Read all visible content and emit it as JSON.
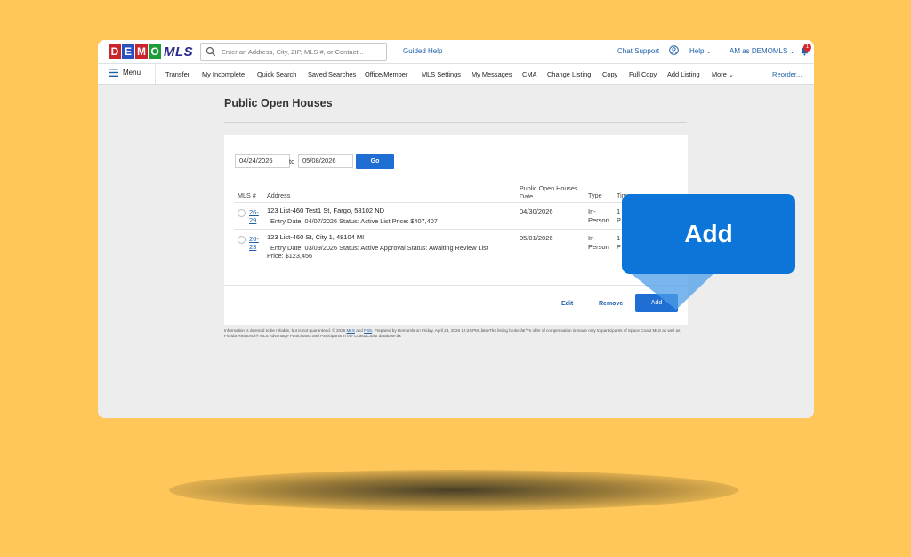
{
  "app": {
    "logo_letters": [
      "D",
      "E",
      "M",
      "O"
    ],
    "logo_colors": [
      "#C8252C",
      "#2A52BE",
      "#C8252C",
      "#1E9B3A"
    ],
    "logo_suffix": "MLS"
  },
  "topbar": {
    "search_placeholder": "Enter an Address, City, ZIP, MLS #, or Contact...",
    "guided_help": "Guided Help",
    "chat_support": "Chat Support",
    "help": "Help",
    "user": "AM as DEMOMLS",
    "notification_count": "1"
  },
  "nav": {
    "menu_label": "Menu",
    "items": [
      "Transfer",
      "My Incomplete",
      "Quick Search",
      "Saved Searches",
      "Office/Member",
      "MLS Settings",
      "My Messages",
      "CMA",
      "Change Listing",
      "Copy",
      "Full Copy",
      "Add Listing",
      "More"
    ],
    "reorder": "Reorder..."
  },
  "page": {
    "title": "Public Open Houses",
    "date_from": "04/24/2026",
    "to_label": "to",
    "date_to": "05/08/2026",
    "go_label": "Go"
  },
  "table": {
    "headers": {
      "mls": "MLS #",
      "address": "Address",
      "date_line1": "Public Open Houses",
      "date_line2": "Date",
      "type": "Type",
      "time": "Time"
    },
    "rows": [
      {
        "mls_line1": "26-",
        "mls_line2": "29",
        "address": "123 List-460 Test1 St, Fargo, 58102 ND",
        "details": "Entry Date: 04/07/2026   Status: Active   List Price: $407,407",
        "date": "04/30/2026",
        "type_line1": "In-",
        "type_line2": "Person",
        "time_line1": "1",
        "time_line2": "P"
      },
      {
        "mls_line1": "26-",
        "mls_line2": "23",
        "address": "123 List-460 St, City 1, 48104 MI",
        "details_line1": "Entry Date: 03/09/2026   Status: Active   Approval Status: Awaiting Review   List",
        "details_line2": "Price: $123,456",
        "date": "05/01/2026",
        "type_line1": "In-",
        "type_line2": "Person",
        "time_line1": "1",
        "time_line2": "P"
      }
    ]
  },
  "actions": {
    "edit": "Edit",
    "remove": "Remove",
    "add": "Add"
  },
  "disclaimer": {
    "part1": "Information is deemed to be reliable, but is not guaranteed. © 2026 ",
    "mls_link": "MLS",
    "and": " and ",
    "fbs_link": "FBS",
    "part2": ". Prepared by Demomls on Friday, April 24, 2026 12:24 PM. â€œThe listing brokerâ€™s offer of compensation is made only to participants of Space Coast MLS as well as Florida RealtorsÂ® MLS Advantage Participants and Participants in the Coast2Coast database.â€"
  },
  "callout": {
    "text": "Add",
    "color": "#0C75DA"
  }
}
